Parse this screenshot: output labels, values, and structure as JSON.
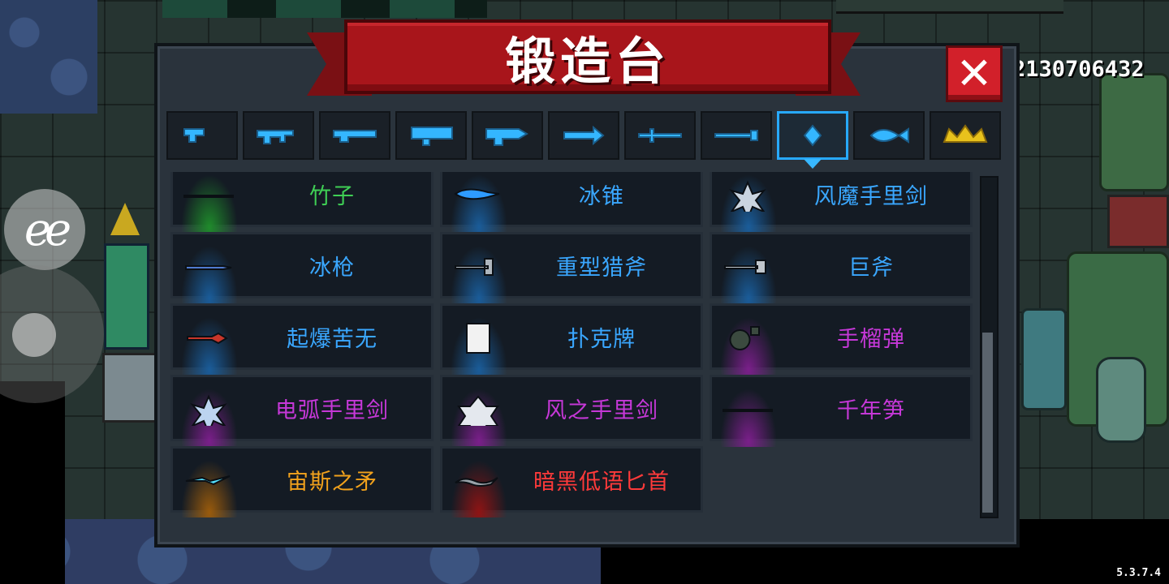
{
  "forge": {
    "title": "锻造台",
    "close_label": "✕",
    "tabs": [
      {
        "icon": "pistol-icon"
      },
      {
        "icon": "rifle-icon"
      },
      {
        "icon": "shotgun-icon"
      },
      {
        "icon": "launcher-icon"
      },
      {
        "icon": "laser-gun-icon"
      },
      {
        "icon": "arrow-icon"
      },
      {
        "icon": "sword-icon"
      },
      {
        "icon": "staff-icon"
      },
      {
        "icon": "throwing-weapon-icon",
        "active": true
      },
      {
        "icon": "fish-icon"
      },
      {
        "icon": "crown-icon"
      }
    ],
    "items": [
      {
        "name": "竹子",
        "color": "#3fcf55",
        "glow": "#1f8a2b"
      },
      {
        "name": "冰锥",
        "color": "#3aa7ff",
        "glow": "#1a5c99"
      },
      {
        "name": "风魔手里剑",
        "color": "#3aa7ff",
        "glow": "#1a5c99"
      },
      {
        "name": "冰枪",
        "color": "#3aa7ff",
        "glow": "#1a5c99"
      },
      {
        "name": "重型猎斧",
        "color": "#3aa7ff",
        "glow": "#1a5c99"
      },
      {
        "name": "巨斧",
        "color": "#3aa7ff",
        "glow": "#1a5c99"
      },
      {
        "name": "起爆苦无",
        "color": "#3aa7ff",
        "glow": "#1a5c99"
      },
      {
        "name": "扑克牌",
        "color": "#3aa7ff",
        "glow": "#1a5c99"
      },
      {
        "name": "手榴弹",
        "color": "#c638d8",
        "glow": "#7a1f8a"
      },
      {
        "name": "电弧手里剑",
        "color": "#c638d8",
        "glow": "#7a1f8a"
      },
      {
        "name": "风之手里剑",
        "color": "#c638d8",
        "glow": "#7a1f8a"
      },
      {
        "name": "千年笋",
        "color": "#c638d8",
        "glow": "#7a1f8a"
      },
      {
        "name": "宙斯之矛",
        "color": "#f2a21c",
        "glow": "#9a5b0c"
      },
      {
        "name": "暗黑低语匕首",
        "color": "#ff3a3a",
        "glow": "#8f1414"
      }
    ]
  },
  "hud": {
    "seed": "2130706432",
    "version": "5.3.7.4",
    "emote_label": "ee"
  }
}
